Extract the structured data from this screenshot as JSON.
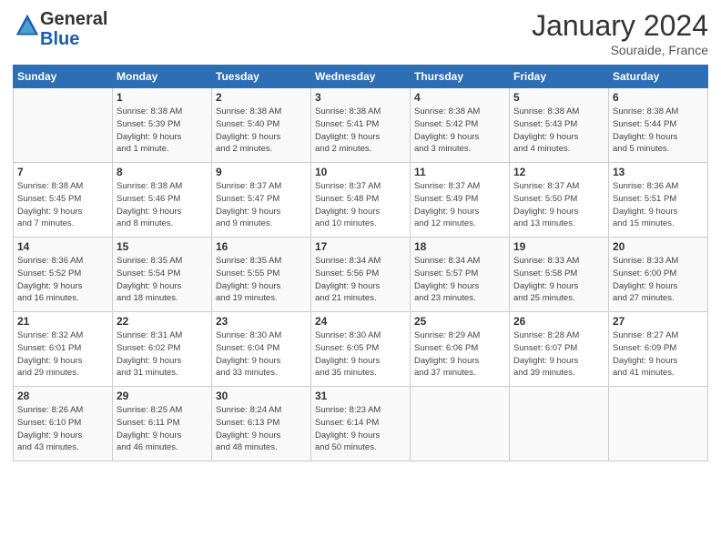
{
  "header": {
    "logo_general": "General",
    "logo_blue": "Blue",
    "month": "January 2024",
    "location": "Souraide, France"
  },
  "weekdays": [
    "Sunday",
    "Monday",
    "Tuesday",
    "Wednesday",
    "Thursday",
    "Friday",
    "Saturday"
  ],
  "weeks": [
    [
      {
        "day": "",
        "sunrise": "",
        "sunset": "",
        "daylight": ""
      },
      {
        "day": "1",
        "sunrise": "8:38 AM",
        "sunset": "5:39 PM",
        "daylight": "9 hours and 1 minute."
      },
      {
        "day": "2",
        "sunrise": "8:38 AM",
        "sunset": "5:40 PM",
        "daylight": "9 hours and 2 minutes."
      },
      {
        "day": "3",
        "sunrise": "8:38 AM",
        "sunset": "5:41 PM",
        "daylight": "9 hours and 2 minutes."
      },
      {
        "day": "4",
        "sunrise": "8:38 AM",
        "sunset": "5:42 PM",
        "daylight": "9 hours and 3 minutes."
      },
      {
        "day": "5",
        "sunrise": "8:38 AM",
        "sunset": "5:43 PM",
        "daylight": "9 hours and 4 minutes."
      },
      {
        "day": "6",
        "sunrise": "8:38 AM",
        "sunset": "5:44 PM",
        "daylight": "9 hours and 5 minutes."
      }
    ],
    [
      {
        "day": "7",
        "sunrise": "8:38 AM",
        "sunset": "5:45 PM",
        "daylight": "9 hours and 7 minutes."
      },
      {
        "day": "8",
        "sunrise": "8:38 AM",
        "sunset": "5:46 PM",
        "daylight": "9 hours and 8 minutes."
      },
      {
        "day": "9",
        "sunrise": "8:37 AM",
        "sunset": "5:47 PM",
        "daylight": "9 hours and 9 minutes."
      },
      {
        "day": "10",
        "sunrise": "8:37 AM",
        "sunset": "5:48 PM",
        "daylight": "9 hours and 10 minutes."
      },
      {
        "day": "11",
        "sunrise": "8:37 AM",
        "sunset": "5:49 PM",
        "daylight": "9 hours and 12 minutes."
      },
      {
        "day": "12",
        "sunrise": "8:37 AM",
        "sunset": "5:50 PM",
        "daylight": "9 hours and 13 minutes."
      },
      {
        "day": "13",
        "sunrise": "8:36 AM",
        "sunset": "5:51 PM",
        "daylight": "9 hours and 15 minutes."
      }
    ],
    [
      {
        "day": "14",
        "sunrise": "8:36 AM",
        "sunset": "5:52 PM",
        "daylight": "9 hours and 16 minutes."
      },
      {
        "day": "15",
        "sunrise": "8:35 AM",
        "sunset": "5:54 PM",
        "daylight": "9 hours and 18 minutes."
      },
      {
        "day": "16",
        "sunrise": "8:35 AM",
        "sunset": "5:55 PM",
        "daylight": "9 hours and 19 minutes."
      },
      {
        "day": "17",
        "sunrise": "8:34 AM",
        "sunset": "5:56 PM",
        "daylight": "9 hours and 21 minutes."
      },
      {
        "day": "18",
        "sunrise": "8:34 AM",
        "sunset": "5:57 PM",
        "daylight": "9 hours and 23 minutes."
      },
      {
        "day": "19",
        "sunrise": "8:33 AM",
        "sunset": "5:58 PM",
        "daylight": "9 hours and 25 minutes."
      },
      {
        "day": "20",
        "sunrise": "8:33 AM",
        "sunset": "6:00 PM",
        "daylight": "9 hours and 27 minutes."
      }
    ],
    [
      {
        "day": "21",
        "sunrise": "8:32 AM",
        "sunset": "6:01 PM",
        "daylight": "9 hours and 29 minutes."
      },
      {
        "day": "22",
        "sunrise": "8:31 AM",
        "sunset": "6:02 PM",
        "daylight": "9 hours and 31 minutes."
      },
      {
        "day": "23",
        "sunrise": "8:30 AM",
        "sunset": "6:04 PM",
        "daylight": "9 hours and 33 minutes."
      },
      {
        "day": "24",
        "sunrise": "8:30 AM",
        "sunset": "6:05 PM",
        "daylight": "9 hours and 35 minutes."
      },
      {
        "day": "25",
        "sunrise": "8:29 AM",
        "sunset": "6:06 PM",
        "daylight": "9 hours and 37 minutes."
      },
      {
        "day": "26",
        "sunrise": "8:28 AM",
        "sunset": "6:07 PM",
        "daylight": "9 hours and 39 minutes."
      },
      {
        "day": "27",
        "sunrise": "8:27 AM",
        "sunset": "6:09 PM",
        "daylight": "9 hours and 41 minutes."
      }
    ],
    [
      {
        "day": "28",
        "sunrise": "8:26 AM",
        "sunset": "6:10 PM",
        "daylight": "9 hours and 43 minutes."
      },
      {
        "day": "29",
        "sunrise": "8:25 AM",
        "sunset": "6:11 PM",
        "daylight": "9 hours and 46 minutes."
      },
      {
        "day": "30",
        "sunrise": "8:24 AM",
        "sunset": "6:13 PM",
        "daylight": "9 hours and 48 minutes."
      },
      {
        "day": "31",
        "sunrise": "8:23 AM",
        "sunset": "6:14 PM",
        "daylight": "9 hours and 50 minutes."
      },
      {
        "day": "",
        "sunrise": "",
        "sunset": "",
        "daylight": ""
      },
      {
        "day": "",
        "sunrise": "",
        "sunset": "",
        "daylight": ""
      },
      {
        "day": "",
        "sunrise": "",
        "sunset": "",
        "daylight": ""
      }
    ]
  ]
}
